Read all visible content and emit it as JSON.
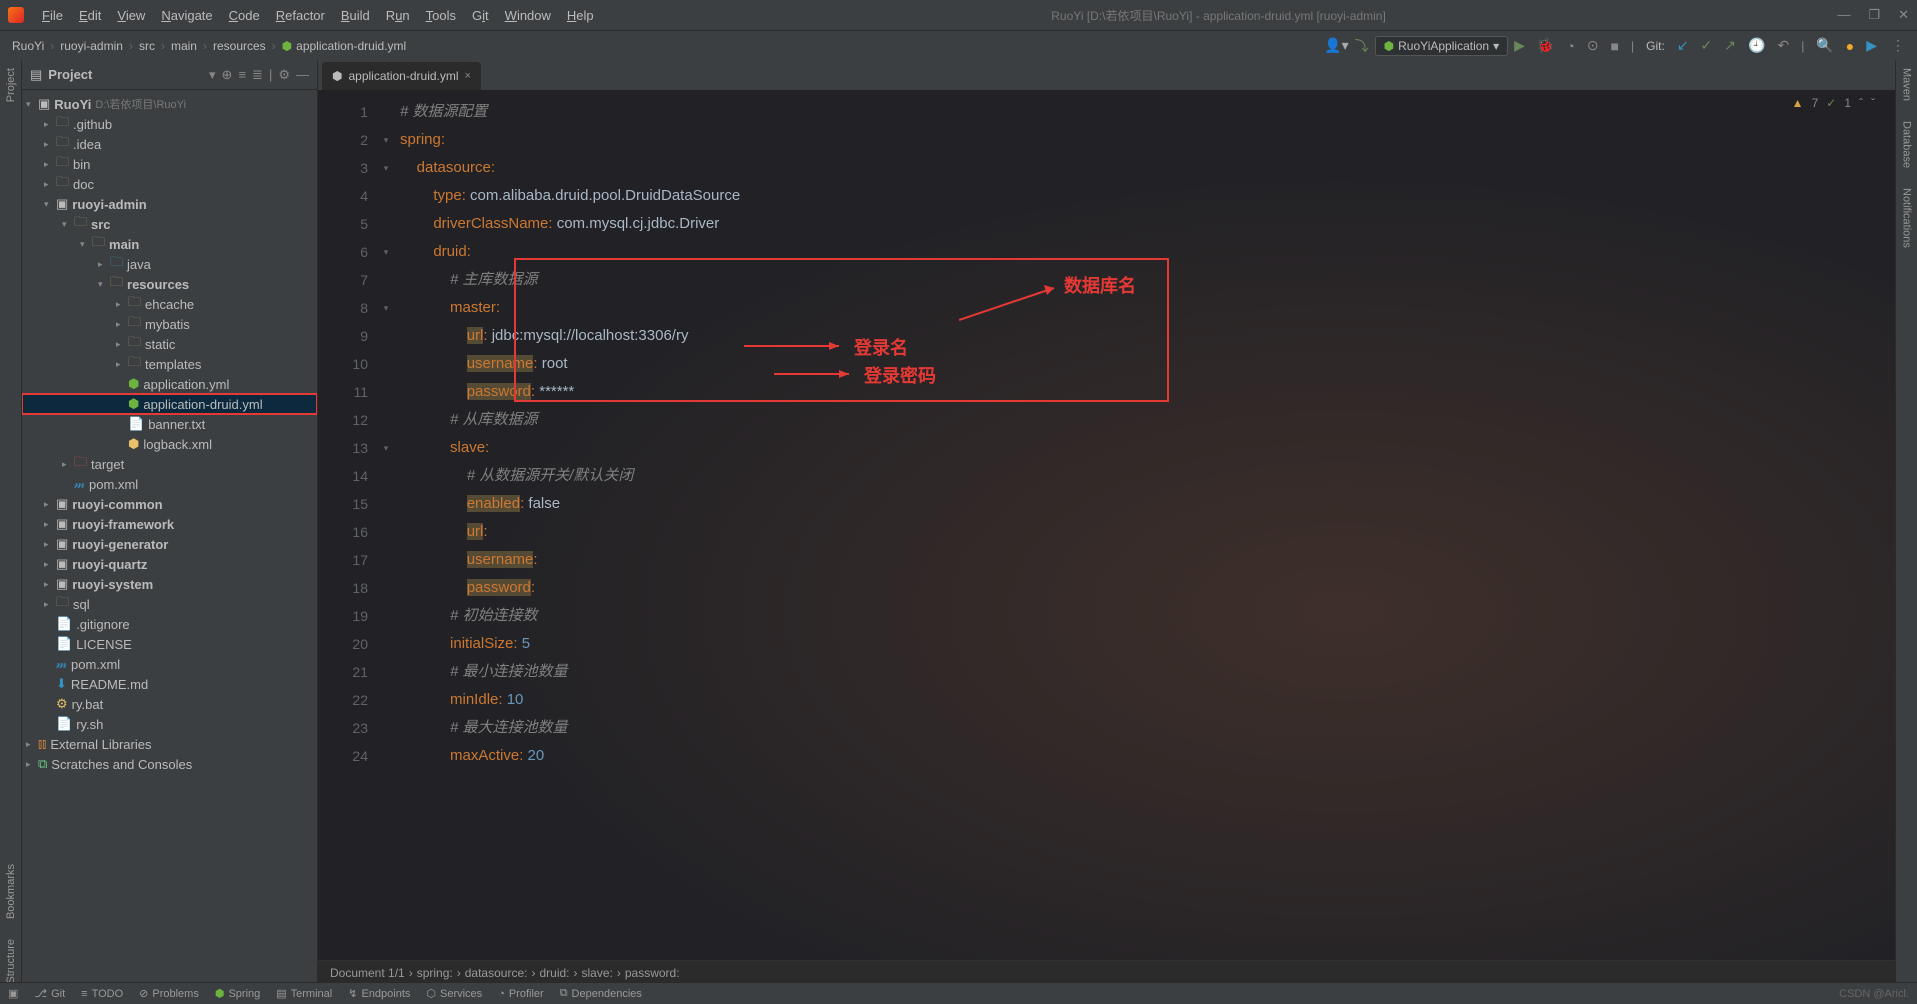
{
  "title": "RuoYi [D:\\若依项目\\RuoYi] - application-druid.yml [ruoyi-admin]",
  "menus": [
    "File",
    "Edit",
    "View",
    "Navigate",
    "Code",
    "Refactor",
    "Build",
    "Run",
    "Tools",
    "Git",
    "Window",
    "Help"
  ],
  "crumbs": [
    "RuoYi",
    "ruoyi-admin",
    "src",
    "main",
    "resources",
    "application-druid.yml"
  ],
  "runconf": "RuoYiApplication",
  "gitlabel": "Git:",
  "inspection": {
    "warn": "7",
    "ok": "1"
  },
  "tab": {
    "name": "application-druid.yml"
  },
  "sidebar": {
    "title": "Project",
    "root": {
      "name": "RuoYi",
      "path": "D:\\若依项目\\RuoYi"
    },
    "items": [
      ".github",
      ".idea",
      "bin",
      "doc",
      "ruoyi-admin",
      "src",
      "main",
      "java",
      "resources",
      "ehcache",
      "mybatis",
      "static",
      "templates",
      "application.yml",
      "application-druid.yml",
      "banner.txt",
      "logback.xml",
      "target",
      "pom.xml",
      "ruoyi-common",
      "ruoyi-framework",
      "ruoyi-generator",
      "ruoyi-quartz",
      "ruoyi-system",
      "sql",
      ".gitignore",
      "LICENSE",
      "pom.xml",
      "README.md",
      "ry.bat",
      "ry.sh",
      "External Libraries",
      "Scratches and Consoles"
    ]
  },
  "code": {
    "lines": [
      "1",
      "2",
      "3",
      "4",
      "5",
      "6",
      "7",
      "8",
      "9",
      "10",
      "11",
      "12",
      "13",
      "14",
      "15",
      "16",
      "17",
      "18",
      "19",
      "20",
      "21",
      "22",
      "23",
      "24"
    ],
    "l1": "# 数据源配置",
    "l2k": "spring",
    "l3k": "datasource",
    "l4k": "type",
    "l4v": "com.alibaba.druid.pool.DruidDataSource",
    "l5k": "driverClassName",
    "l5v": "com.mysql.cj.jdbc.Driver",
    "l6k": "druid",
    "l7": "# 主库数据源",
    "l8k": "master",
    "l9k": "url",
    "l9v": "jdbc:mysql://localhost:3306/ry",
    "l10k": "username",
    "l10v": "root",
    "l11k": "password",
    "l11v": "******",
    "l12": "# 从库数据源",
    "l13k": "slave",
    "l14": "# 从数据源开关/默认关闭",
    "l15k": "enabled",
    "l15v": "false",
    "l16k": "url",
    "l17k": "username",
    "l18k": "password",
    "l19": "# 初始连接数",
    "l20k": "initialSize",
    "l20v": "5",
    "l21": "# 最小连接池数量",
    "l22k": "minIdle",
    "l22v": "10",
    "l23": "# 最大连接池数量",
    "l24k": "maxActive",
    "l24v": "20"
  },
  "annotations": {
    "db": "数据库名",
    "user": "登录名",
    "pwd": "登录密码"
  },
  "breadcrumb": [
    "Document 1/1",
    "spring:",
    "datasource:",
    "druid:",
    "slave:",
    "password:"
  ],
  "statusbar": [
    "Git",
    "TODO",
    "Problems",
    "Spring",
    "Terminal",
    "Endpoints",
    "Services",
    "Profiler",
    "Dependencies"
  ],
  "watermark": "CSDN @Aricl.",
  "leftTools": [
    "Project",
    "Bookmarks",
    "Structure"
  ],
  "rightTools": [
    "Maven",
    "Database",
    "Notifications"
  ]
}
